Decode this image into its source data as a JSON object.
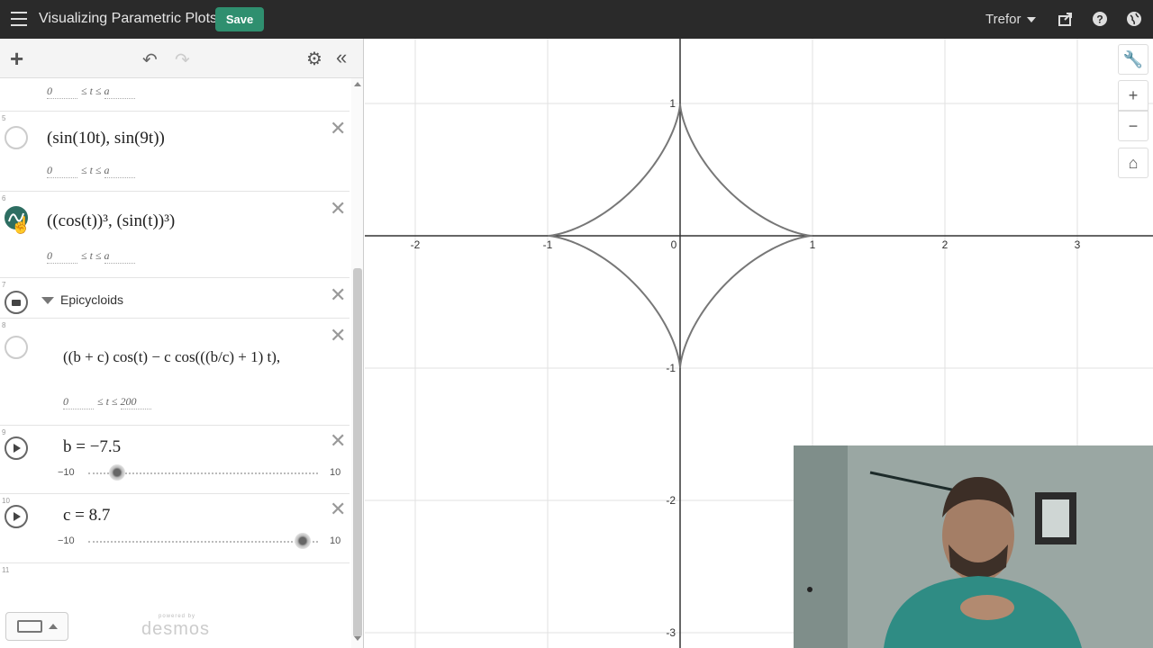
{
  "header": {
    "title": "Visualizing Parametric Plots",
    "save_label": "Save",
    "user": "Trefor"
  },
  "icons": {
    "menu": "hamburger-icon",
    "share": "share-icon",
    "help": "help-icon",
    "language": "globe-icon",
    "add": "plus-icon",
    "undo": "undo-icon",
    "redo": "redo-icon",
    "settings": "gear-icon",
    "collapse": "double-chevron-left-icon",
    "wrench": "wrench-icon",
    "zoom_in": "plus-icon",
    "zoom_out": "minus-icon",
    "home": "home-icon",
    "keyboard": "keyboard-icon"
  },
  "expressions": {
    "row4_domain": {
      "min": "0",
      "op": "≤ t ≤",
      "max": "a"
    },
    "row5": {
      "num": "5",
      "latex": "(sin(10t), sin(9t))",
      "domain_min": "0",
      "domain_op": "≤ t ≤",
      "domain_max": "a"
    },
    "row6": {
      "num": "6",
      "latex": "((cos(t))³, (sin(t))³)",
      "domain_min": "0",
      "domain_op": "≤ t ≤",
      "domain_max": "a"
    },
    "row7": {
      "num": "7",
      "folder_label": "Epicycloids"
    },
    "row8": {
      "num": "8",
      "latex": "((b + c) cos(t) − c cos(((b/c) + 1) t),",
      "domain_min": "0",
      "domain_op": "≤ t ≤",
      "domain_max": "200"
    },
    "row9": {
      "num": "9",
      "latex": "b = −7.5",
      "slider_min": "−10",
      "slider_max": "10",
      "value": -7.5
    },
    "row10": {
      "num": "10",
      "latex": "c = 8.7",
      "slider_min": "−10",
      "slider_max": "10",
      "value": 8.7
    },
    "row11": {
      "num": "11"
    }
  },
  "footer": {
    "powered_by": "powered by",
    "brand": "desmos"
  },
  "graph": {
    "x_ticks": [
      "-2",
      "-1",
      "0",
      "1",
      "2",
      "3"
    ],
    "y_ticks": [
      "1",
      "-1",
      "-2",
      "-3"
    ],
    "curve": "astroid",
    "curve_color": "#777777",
    "axis_color": "#333333",
    "grid_color": "#e0e0e0"
  },
  "colors": {
    "save_green": "#2f8f6f",
    "active_row": "#2e6e62",
    "topbar": "#2a2a2a"
  }
}
